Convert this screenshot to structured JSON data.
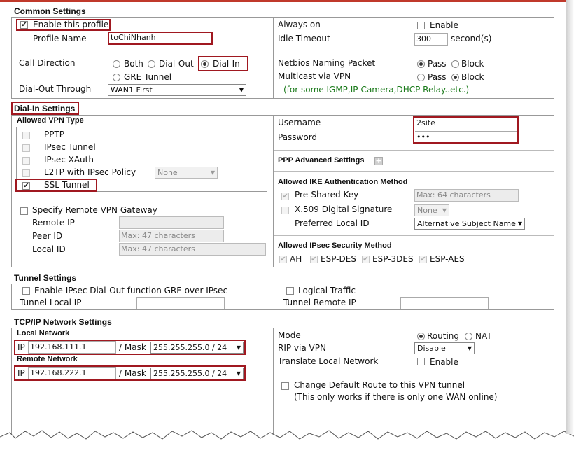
{
  "common": {
    "title": "Common Settings",
    "enable_profile": "Enable this profile",
    "profile_name_label": "Profile Name",
    "profile_name_value": "toChiNhanh",
    "call_direction_label": "Call Direction",
    "dir_both": "Both",
    "dir_dialout": "Dial-Out",
    "dir_dialin": "Dial-In",
    "dir_gre": "GRE Tunnel",
    "dialout_through_label": "Dial-Out Through",
    "dialout_through_value": "WAN1 First",
    "always_on_label": "Always on",
    "always_on_enable": "Enable",
    "idle_timeout_label": "Idle Timeout",
    "idle_timeout_value": "300",
    "idle_timeout_unit": "second(s)",
    "netbios_label": "Netbios Naming Packet",
    "netbios_pass": "Pass",
    "netbios_block": "Block",
    "multicast_label": "Multicast via VPN",
    "multicast_pass": "Pass",
    "multicast_block": "Block",
    "multicast_note": "(for some IGMP,IP-Camera,DHCP Relay..etc.)"
  },
  "dialin": {
    "title": "Dial-In Settings",
    "allowed_vpn_title": "Allowed VPN Type",
    "pptp": "PPTP",
    "ipsec_tunnel": "IPsec Tunnel",
    "ipsec_xauth": "IPsec XAuth",
    "l2tp": "L2TP with IPsec Policy",
    "l2tp_policy": "None",
    "ssl_tunnel": "SSL Tunnel",
    "specify_gateway": "Specify Remote VPN Gateway",
    "remote_ip_label": "Remote IP",
    "peer_id_label": "Peer ID",
    "peer_id_placeholder": "Max: 47 characters",
    "local_id_label": "Local ID",
    "local_id_placeholder": "Max: 47 characters",
    "username_label": "Username",
    "username_value": "2site",
    "password_label": "Password",
    "password_value": "•••",
    "ppp_advanced": "PPP Advanced Settings",
    "ike_title": "Allowed IKE Authentication Method",
    "psk": "Pre-Shared Key",
    "psk_placeholder": "Max: 64 characters",
    "x509": "X.509 Digital Signature",
    "x509_value": "None",
    "pref_local_id_label": "Preferred Local ID",
    "pref_local_id_value": "Alternative Subject Name",
    "ipsec_sec_title": "Allowed IPsec Security Method",
    "ah": "AH",
    "esp_des": "ESP-DES",
    "esp_3des": "ESP-3DES",
    "esp_aes": "ESP-AES"
  },
  "tunnel": {
    "title": "Tunnel Settings",
    "gre_over_ipsec": "Enable IPsec Dial-Out function GRE over IPsec",
    "logical_traffic": "Logical Traffic",
    "local_ip_label": "Tunnel Local IP",
    "remote_ip_label": "Tunnel Remote IP"
  },
  "tcpip": {
    "title": "TCP/IP Network Settings",
    "local_network_title": "Local Network",
    "ip_label": "IP",
    "local_ip": "192.168.111.1",
    "mask_label": "/ Mask",
    "local_mask": "255.255.255.0 / 24",
    "remote_network_title": "Remote Network",
    "remote_ip": "192.168.222.1",
    "remote_mask": "255.255.255.0 / 24",
    "mode_label": "Mode",
    "mode_routing": "Routing",
    "mode_nat": "NAT",
    "rip_label": "RIP via VPN",
    "rip_value": "Disable",
    "translate_label": "Translate Local Network",
    "translate_enable": "Enable",
    "default_route": "Change Default Route to this VPN tunnel",
    "default_route_note": "(This only works if there is only one WAN online)"
  },
  "colors": {
    "highlight": "#a01820",
    "note_green": "#1a7a1a",
    "top_bar": "#c0392b"
  }
}
